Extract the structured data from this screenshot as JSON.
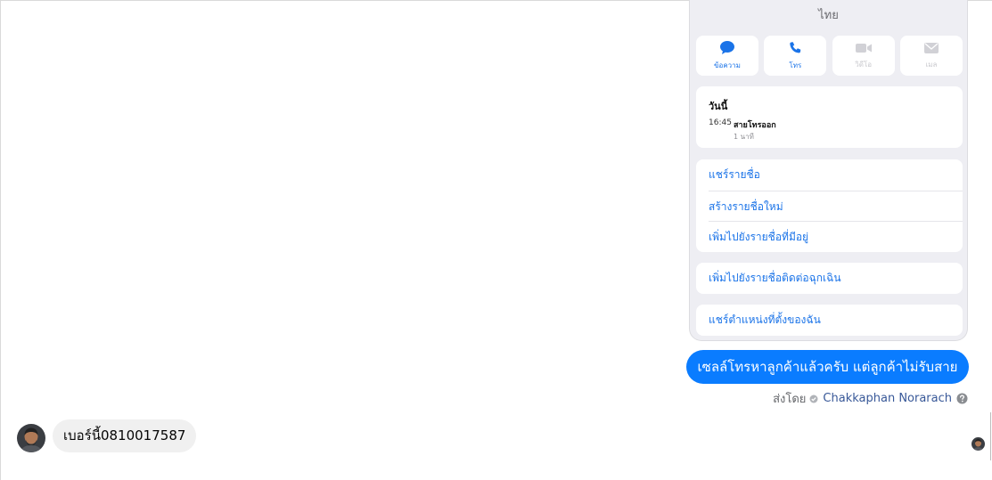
{
  "screenshot": {
    "title": "ไทย",
    "actions": [
      {
        "label": "ข้อความ",
        "icon": "message-icon",
        "enabled": true
      },
      {
        "label": "โทร",
        "icon": "phone-icon",
        "enabled": true
      },
      {
        "label": "วิดีโอ",
        "icon": "video-icon",
        "enabled": false
      },
      {
        "label": "เมล",
        "icon": "mail-icon",
        "enabled": false
      }
    ],
    "recent": {
      "heading": "วันนี้",
      "time": "16:45",
      "description": "สายโทรออก",
      "duration": "1 นาที"
    },
    "list_items": [
      "แชร์รายชื่อ",
      "สร้างรายชื่อใหม่",
      "เพิ่มไปยังรายชื่อที่มีอยู่"
    ],
    "emergency": "เพิ่มไปยังรายชื่อติดต่อฉุกเฉิน",
    "share_location": "แชร์ตำแหน่งที่ตั้งของฉัน"
  },
  "outgoing_message": "เซลล์โทรหาลูกค้าแล้วครับ แต่ลูกค้าไม่รับสาย",
  "sent_by": {
    "prefix": "ส่งโดย",
    "name": "Chakkaphan Norarach",
    "verified_icon": "check-circle-icon",
    "help_icon": "help-icon"
  },
  "incoming_message": "เบอร์นี้0810017587",
  "colors": {
    "brand_blue": "#0a7cff",
    "ios_blue": "#1a73e8",
    "incoming_bubble": "#f0f0f0"
  }
}
